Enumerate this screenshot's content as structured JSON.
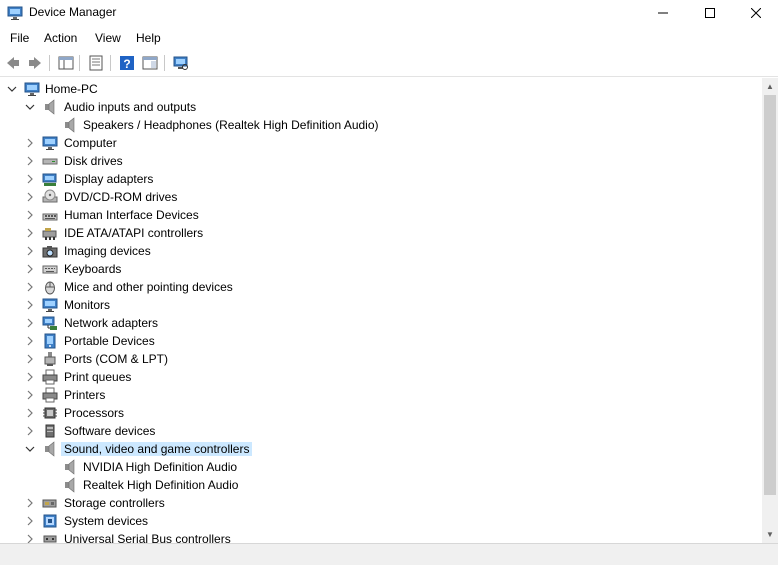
{
  "window": {
    "title": "Device Manager"
  },
  "menu": [
    "File",
    "Action",
    "View",
    "Help"
  ],
  "toolbar": [
    "back-icon",
    "forward-icon",
    "|",
    "properties-view-icon",
    "|",
    "console-tree-icon",
    "|",
    "help-icon",
    "show-hide-icon",
    "|",
    "scan-hardware-icon"
  ],
  "tree": {
    "root": "Home-PC",
    "items": [
      {
        "label": "Audio inputs and outputs",
        "icon": "speaker-icon",
        "expanded": true,
        "children": [
          "Speakers / Headphones (Realtek High Definition Audio)"
        ]
      },
      {
        "label": "Computer",
        "icon": "monitor-icon"
      },
      {
        "label": "Disk drives",
        "icon": "disk-drive-icon"
      },
      {
        "label": "Display adapters",
        "icon": "display-adapter-icon"
      },
      {
        "label": "DVD/CD-ROM drives",
        "icon": "dvd-drive-icon"
      },
      {
        "label": "Human Interface Devices",
        "icon": "hid-icon"
      },
      {
        "label": "IDE ATA/ATAPI controllers",
        "icon": "ide-controller-icon"
      },
      {
        "label": "Imaging devices",
        "icon": "camera-icon"
      },
      {
        "label": "Keyboards",
        "icon": "keyboard-icon"
      },
      {
        "label": "Mice and other pointing devices",
        "icon": "mouse-icon"
      },
      {
        "label": "Monitors",
        "icon": "monitor-icon"
      },
      {
        "label": "Network adapters",
        "icon": "network-adapter-icon"
      },
      {
        "label": "Portable Devices",
        "icon": "portable-device-icon"
      },
      {
        "label": "Ports (COM & LPT)",
        "icon": "port-icon"
      },
      {
        "label": "Print queues",
        "icon": "printer-icon"
      },
      {
        "label": "Printers",
        "icon": "printer-icon"
      },
      {
        "label": "Processors",
        "icon": "processor-icon"
      },
      {
        "label": "Software devices",
        "icon": "software-device-icon"
      },
      {
        "label": "Sound, video and game controllers",
        "icon": "speaker-icon",
        "expanded": true,
        "selected": true,
        "children": [
          "NVIDIA High Definition Audio",
          "Realtek High Definition Audio"
        ]
      },
      {
        "label": "Storage controllers",
        "icon": "storage-controller-icon"
      },
      {
        "label": "System devices",
        "icon": "system-device-icon"
      },
      {
        "label": "Universal Serial Bus controllers",
        "icon": "usb-icon"
      }
    ]
  },
  "colors": {
    "selection": "#cce8ff",
    "accent": "#3f80c7"
  }
}
